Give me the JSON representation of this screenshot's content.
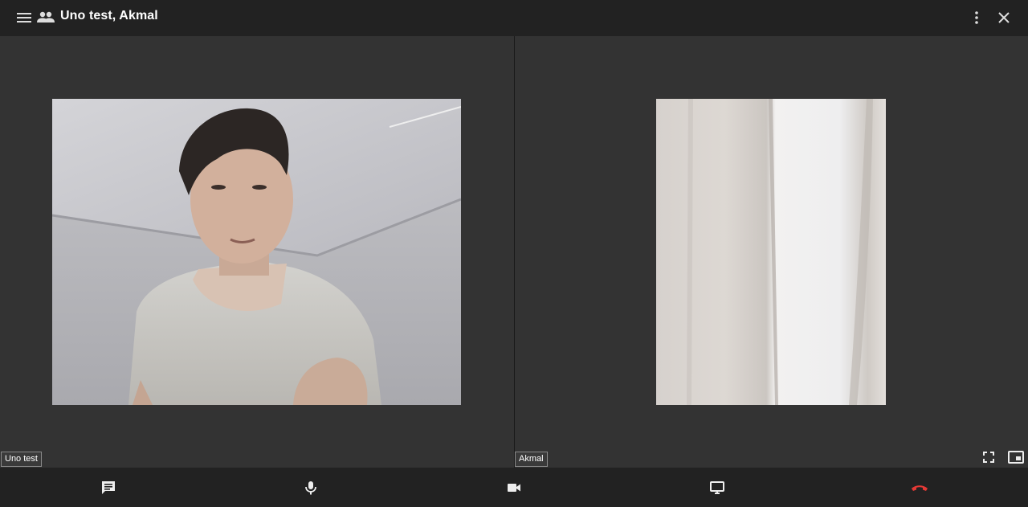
{
  "header": {
    "title": "Uno test, Akmal",
    "icons": {
      "menu": "menu-icon",
      "participants": "people-icon",
      "more": "more-vert-icon",
      "close": "close-icon"
    }
  },
  "participants": [
    {
      "name": "Uno test"
    },
    {
      "name": "Akmal"
    }
  ],
  "video_controls": {
    "fullscreen": "fullscreen-icon",
    "pip": "picture-in-picture-icon"
  },
  "toolbar": {
    "buttons": [
      {
        "id": "chat",
        "icon": "chat-icon"
      },
      {
        "id": "mic",
        "icon": "microphone-icon"
      },
      {
        "id": "camera",
        "icon": "videocam-icon"
      },
      {
        "id": "screen_share",
        "icon": "monitor-icon"
      },
      {
        "id": "hang_up",
        "icon": "call-end-icon",
        "color": "#e53935"
      }
    ]
  },
  "colors": {
    "header_bg": "#222222",
    "panel_bg": "#333333",
    "hangup": "#e53935"
  }
}
